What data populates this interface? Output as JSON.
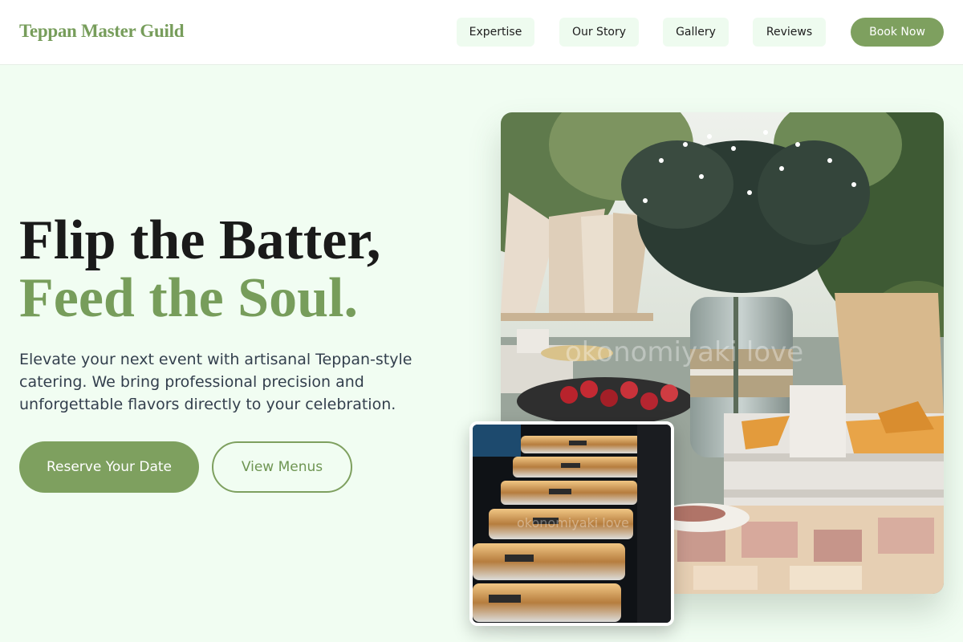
{
  "header": {
    "logo": "Teppan Master Guild",
    "nav": [
      {
        "label": "Expertise"
      },
      {
        "label": "Our Story"
      },
      {
        "label": "Gallery"
      },
      {
        "label": "Reviews"
      }
    ],
    "cta_label": "Book Now"
  },
  "hero": {
    "headline_line1": "Flip the Batter,",
    "headline_line2": "Feed the Soul.",
    "description": "Elevate your next event with artisanal Teppan-style catering. We bring professional precision and unforgettable flavors directly to your celebration.",
    "primary_button": "Reserve Your Date",
    "secondary_button": "View Menus"
  },
  "images": {
    "main_watermark": "okonomiyaki love",
    "small_watermark": "okonomiyaki love"
  },
  "colors": {
    "brand_green": "#7ea05f",
    "page_background": "#f1fdf2",
    "nav_pill": "#eefbef",
    "headline_dark": "#1a1a1a"
  }
}
